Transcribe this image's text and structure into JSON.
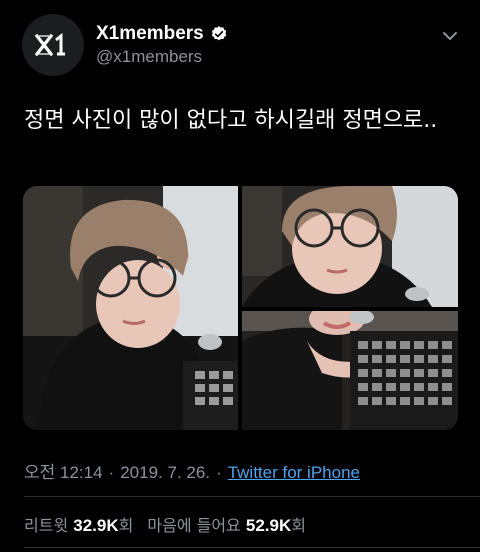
{
  "tweet": {
    "author": {
      "display_name": "X1members",
      "handle": "@x1members",
      "avatar_text": "X1",
      "verified": true
    },
    "text": "정면 사진이 많이 없다고 하시길래 정면으로..",
    "media_count": 3,
    "meta": {
      "time": "오전 12:14",
      "separator": "·",
      "date": "2019. 7. 26.",
      "source": "Twitter for iPhone"
    },
    "stats": {
      "retweets_label": "리트윗",
      "retweets_count": "32.9K",
      "retweets_unit": "회",
      "likes_label": "마음에 들어요",
      "likes_count": "52.9K",
      "likes_unit": "회"
    }
  },
  "icons": {
    "verified": "verified-badge-icon",
    "more": "chevron-down-icon"
  },
  "colors": {
    "background": "#000000",
    "link": "#4ea4f0",
    "secondary_text": "#8b949b"
  }
}
